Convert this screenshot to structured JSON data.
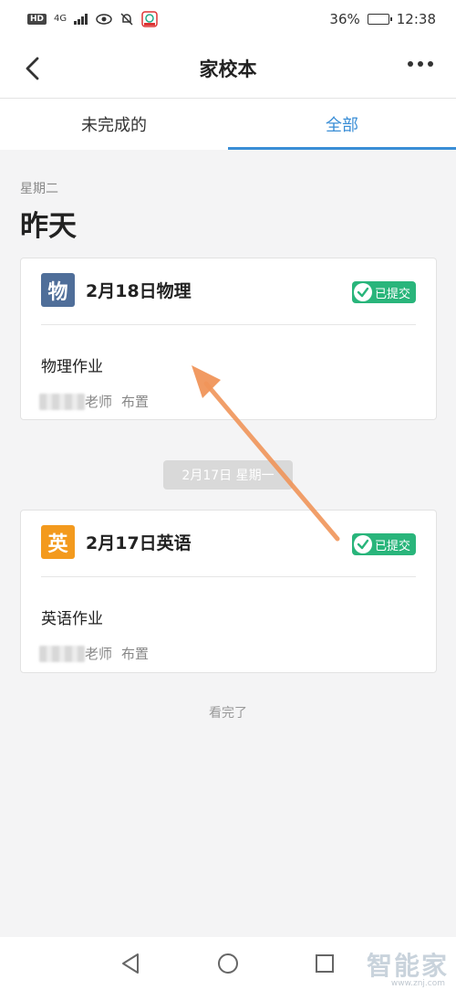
{
  "status_bar": {
    "hd": "HD",
    "network": "4G",
    "battery_percent": "36%",
    "battery_level": 0.36,
    "time": "12:38"
  },
  "navbar": {
    "title": "家校本",
    "back_icon": "chevron-left-icon",
    "more_icon": "more-horizontal-icon"
  },
  "tabs": [
    {
      "label": "未完成的",
      "active": false
    },
    {
      "label": "全部",
      "active": true
    }
  ],
  "section": {
    "weekday": "星期二",
    "day": "昨天"
  },
  "cards": [
    {
      "icon_char": "物",
      "icon_color": "#4f6e99",
      "title": "2月18日物理",
      "badge": "已提交",
      "body_title": "物理作业",
      "teacher_suffix": "老师",
      "assign": "布置"
    },
    {
      "icon_char": "英",
      "icon_color": "#f39a1e",
      "title": "2月17日英语",
      "badge": "已提交",
      "body_title": "英语作业",
      "teacher_suffix": "老师",
      "assign": "布置"
    }
  ],
  "date_divider": "2月17日 星期一",
  "end_text": "看完了",
  "colors": {
    "accent": "#3a8ed6",
    "badge_green": "#29b57b",
    "annotation_arrow": "#f0955a"
  },
  "watermark": {
    "text": "智能家",
    "url": "www.znj.com"
  }
}
